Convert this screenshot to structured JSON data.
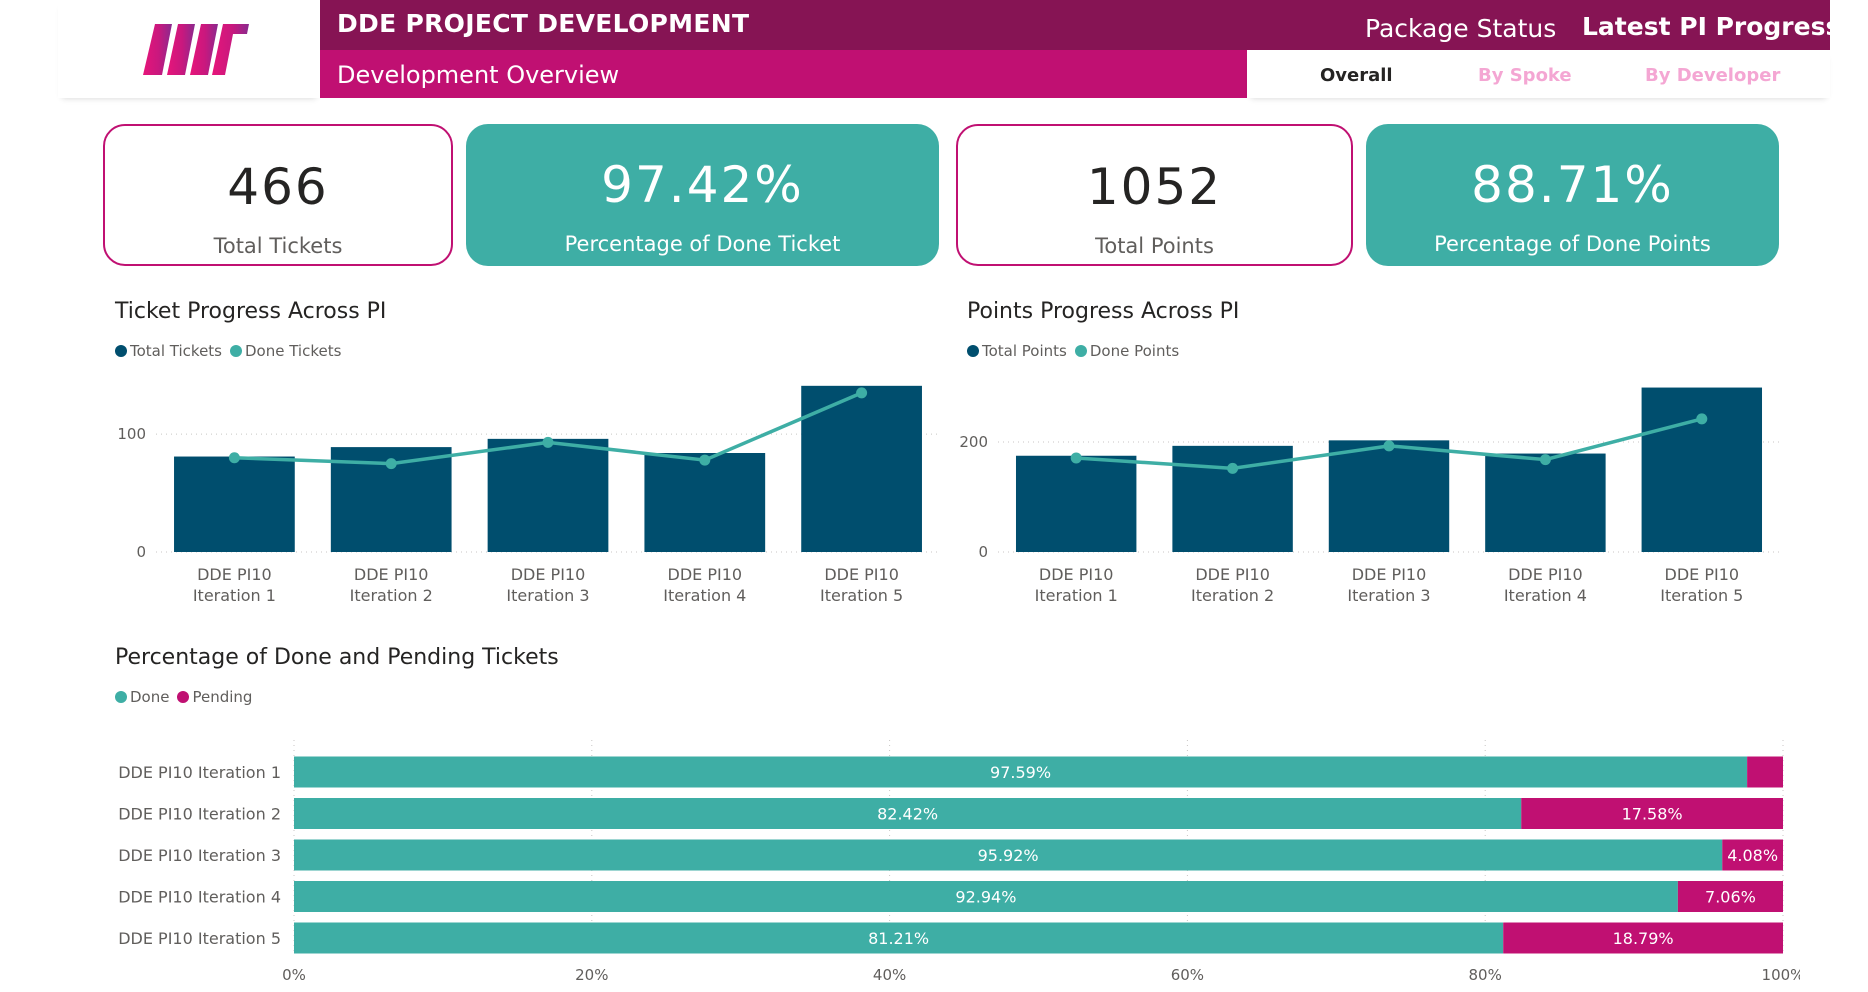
{
  "header": {
    "title": "DDE PROJECT DEVELOPMENT",
    "subtitle": "Development Overview",
    "nav": {
      "package_status": "Package Status",
      "latest_pi": "Latest PI Progress"
    },
    "tabs": [
      "Overall",
      "By Spoke",
      "By Developer"
    ],
    "logo_icon": "brand-logo-icon",
    "colors": {
      "title_bar": "#861454",
      "subtitle_bar": "#c01072",
      "tab_active": "#252423",
      "tab_inactive": "#f4a6d3"
    }
  },
  "kpis": [
    {
      "value": "466",
      "label": "Total Tickets",
      "style": "white"
    },
    {
      "value": "97.42%",
      "label": "Percentage of Done Ticket",
      "style": "teal"
    },
    {
      "value": "1052",
      "label": "Total Points",
      "style": "white"
    },
    {
      "value": "88.71%",
      "label": "Percentage of Done Points",
      "style": "teal"
    }
  ],
  "colors": {
    "bar": "#004e6e",
    "line": "#3eaea5",
    "done": "#3eaea5",
    "pending": "#c01072"
  },
  "chart_data": [
    {
      "type": "bar",
      "title": "Ticket Progress Across PI",
      "legend": [
        "Total Tickets",
        "Done Tickets"
      ],
      "categories": [
        [
          "DDE PI10",
          "Iteration 1"
        ],
        [
          "DDE PI10",
          "Iteration 2"
        ],
        [
          "DDE PI10",
          "Iteration 3"
        ],
        [
          "DDE PI10",
          "Iteration 4"
        ],
        [
          "DDE PI10",
          "Iteration 5"
        ]
      ],
      "series": [
        {
          "name": "Total Tickets",
          "type": "bar",
          "values": [
            81,
            89,
            96,
            84,
            141
          ]
        },
        {
          "name": "Done Tickets",
          "type": "line",
          "values": [
            80,
            75,
            93,
            78,
            135
          ]
        }
      ],
      "yticks": [
        "0",
        "100"
      ],
      "ylim": [
        0,
        140
      ],
      "grid": "dotted"
    },
    {
      "type": "bar",
      "title": "Points Progress Across PI",
      "legend": [
        "Total Points",
        "Done Points"
      ],
      "categories": [
        [
          "DDE PI10",
          "Iteration 1"
        ],
        [
          "DDE PI10",
          "Iteration 2"
        ],
        [
          "DDE PI10",
          "Iteration 3"
        ],
        [
          "DDE PI10",
          "Iteration 4"
        ],
        [
          "DDE PI10",
          "Iteration 5"
        ]
      ],
      "series": [
        {
          "name": "Total Points",
          "type": "bar",
          "values": [
            175,
            193,
            203,
            179,
            299
          ]
        },
        {
          "name": "Done Points",
          "type": "line",
          "values": [
            171,
            152,
            193,
            168,
            242
          ]
        }
      ],
      "yticks": [
        "0",
        "200"
      ],
      "ylim": [
        0,
        300
      ],
      "grid": "dotted"
    },
    {
      "type": "bar",
      "orientation": "horizontal-stacked-100",
      "title": "Percentage of Done and Pending Tickets",
      "legend": [
        "Done",
        "Pending"
      ],
      "categories": [
        "DDE PI10 Iteration 1",
        "DDE PI10 Iteration 2",
        "DDE PI10 Iteration 3",
        "DDE PI10 Iteration 4",
        "DDE PI10 Iteration 5"
      ],
      "series": [
        {
          "name": "Done",
          "values": [
            97.59,
            82.42,
            95.92,
            92.94,
            81.21
          ],
          "labels": [
            "97.59%",
            "82.42%",
            "95.92%",
            "92.94%",
            "81.21%"
          ]
        },
        {
          "name": "Pending",
          "values": [
            2.41,
            17.58,
            4.08,
            7.06,
            18.79
          ],
          "labels": [
            "",
            "17.58%",
            "4.08%",
            "7.06%",
            "18.79%"
          ]
        }
      ],
      "xticks": [
        "0%",
        "20%",
        "40%",
        "60%",
        "80%",
        "100%"
      ],
      "xlim": [
        0,
        100
      ]
    }
  ]
}
